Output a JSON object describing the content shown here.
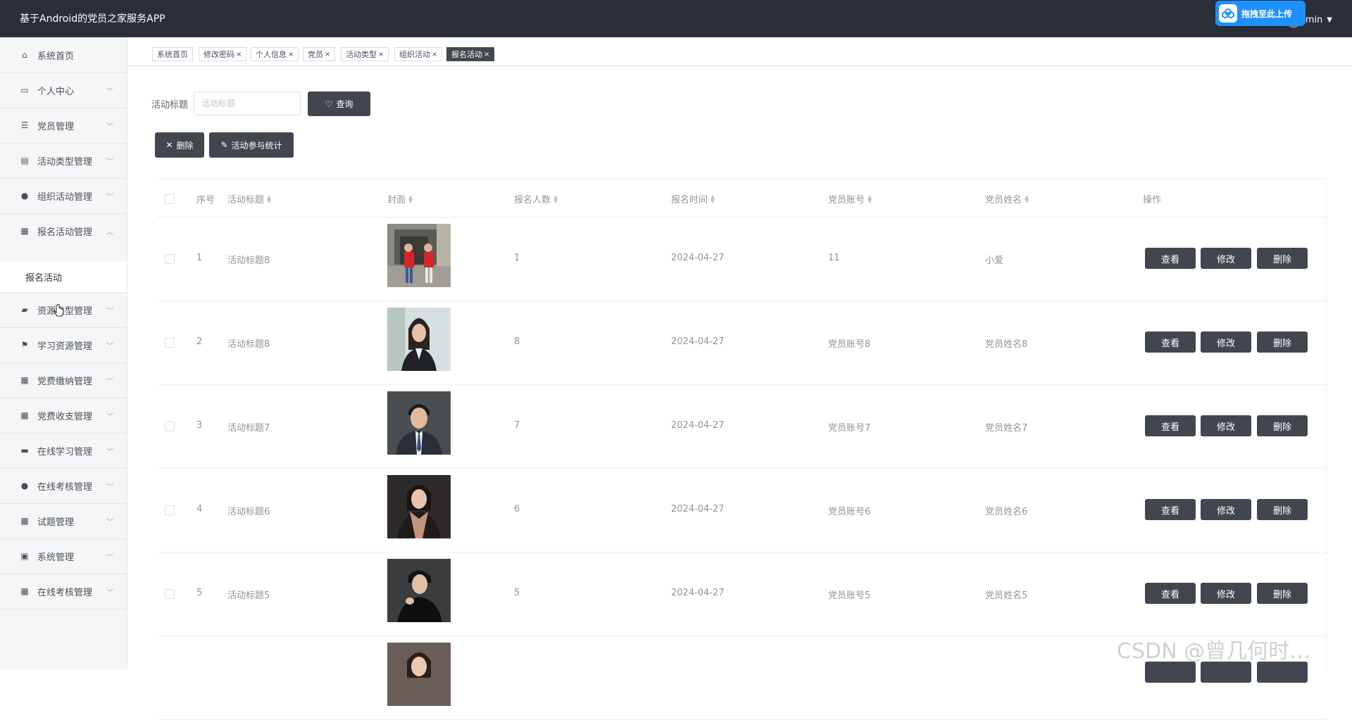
{
  "app": {
    "title": "基于Android的党员之家服务APP",
    "user": "min",
    "upload_label": "拖拽至此上传"
  },
  "sidebar": {
    "items": [
      {
        "label": "系统首页",
        "icon": "home-icon",
        "arrow": ""
      },
      {
        "label": "个人中心",
        "icon": "id-card-icon",
        "arrow": "⌄"
      },
      {
        "label": "党员管理",
        "icon": "list-icon",
        "arrow": "⌄"
      },
      {
        "label": "活动类型管理",
        "icon": "clipboard-icon",
        "arrow": "⌄"
      },
      {
        "label": "组织活动管理",
        "icon": "user-icon",
        "arrow": "⌄"
      },
      {
        "label": "报名活动管理",
        "icon": "grid-icon",
        "arrow": "⌃"
      },
      {
        "label": "资源类型管理",
        "icon": "wallet-icon",
        "arrow": "⌄"
      },
      {
        "label": "学习资源管理",
        "icon": "flag-icon",
        "arrow": "⌄"
      },
      {
        "label": "党费缴纳管理",
        "icon": "grid-icon",
        "arrow": "⌄"
      },
      {
        "label": "党费收支管理",
        "icon": "grid-icon",
        "arrow": "⌄"
      },
      {
        "label": "在线学习管理",
        "icon": "stamp-icon",
        "arrow": "⌄"
      },
      {
        "label": "在线考核管理",
        "icon": "user-icon",
        "arrow": "⌄"
      },
      {
        "label": "试题管理",
        "icon": "grid-icon",
        "arrow": "⌄"
      },
      {
        "label": "系统管理",
        "icon": "briefcase-icon",
        "arrow": "⌄"
      },
      {
        "label": "在线考核管理",
        "icon": "grid-icon",
        "arrow": "⌄"
      }
    ],
    "sub_item": "报名活动"
  },
  "tabs": [
    {
      "label": "系统首页",
      "closable": false
    },
    {
      "label": "修改密码",
      "closable": true
    },
    {
      "label": "个人信息",
      "closable": true
    },
    {
      "label": "党员",
      "closable": true
    },
    {
      "label": "活动类型",
      "closable": true
    },
    {
      "label": "组织活动",
      "closable": true
    },
    {
      "label": "报名活动",
      "closable": true,
      "active": true
    }
  ],
  "search": {
    "label": "活动标题",
    "placeholder": "活动标题",
    "query_button": "查询"
  },
  "actions": {
    "delete": "删除",
    "stats": "活动参与统计"
  },
  "table": {
    "headers": [
      "序号",
      "活动标题",
      "封面",
      "报名人数",
      "报名时间",
      "党员账号",
      "党员姓名",
      "操作"
    ],
    "rows": [
      {
        "index": "1",
        "title": "活动标题8",
        "count": "1",
        "time": "2024-04-27",
        "account": "11",
        "name": "小爱"
      },
      {
        "index": "2",
        "title": "活动标题8",
        "count": "8",
        "time": "2024-04-27",
        "account": "党员账号8",
        "name": "党员姓名8"
      },
      {
        "index": "3",
        "title": "活动标题7",
        "count": "7",
        "time": "2024-04-27",
        "account": "党员账号7",
        "name": "党员姓名7"
      },
      {
        "index": "4",
        "title": "活动标题6",
        "count": "6",
        "time": "2024-04-27",
        "account": "党员账号6",
        "name": "党员姓名6"
      },
      {
        "index": "5",
        "title": "活动标题5",
        "count": "5",
        "time": "2024-04-27",
        "account": "党员账号5",
        "name": "党员姓名5"
      }
    ],
    "ops": {
      "view": "查看",
      "edit": "修改",
      "delete": "删除"
    }
  },
  "watermark": "CSDN @曾几何时…",
  "colors": {
    "topbar": "#2b3038",
    "button": "#42474f",
    "upload": "#1e90ff"
  }
}
